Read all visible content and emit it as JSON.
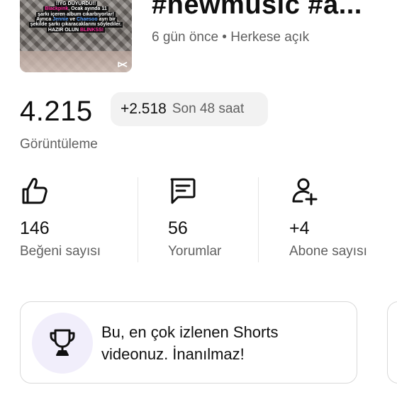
{
  "video": {
    "title": "#newmusic #a...",
    "meta": "6 gün önce • Herkese açık",
    "thumbnail_caption": {
      "line1": "!!YG DUYURDU!!",
      "line2_a": "Blackpink",
      "line2_b": ", Ocak ayında 11",
      "line3": "şarkı içeren album cıkarbıyorlar!",
      "line4_a": "Ayrıca ",
      "line4_b": "Jennie",
      "line4_c": " ve ",
      "line4_d": "Chaesoo",
      "line4_e": " ayrı bir",
      "line5": "şekilde şarkı çıkaracaklarını söylediler.",
      "line6_a": "HAZIR OLUN ",
      "line6_b": "BLINKSS!"
    }
  },
  "views": {
    "count": "4.215",
    "growth": "+2.518",
    "period": "Son 48 saat",
    "label": "Görüntüleme"
  },
  "stats": [
    {
      "icon": "thumbs-up-icon",
      "value": "146",
      "label": "Beğeni sayısı"
    },
    {
      "icon": "comment-icon",
      "value": "56",
      "label": "Yorumlar"
    },
    {
      "icon": "add-subscriber-icon",
      "value": "+4",
      "label": "Abone sayısı"
    }
  ],
  "insight": {
    "icon": "trophy-icon",
    "text": "Bu, en çok izlenen Shorts videonuz. İnanılmaz!"
  },
  "colors": {
    "text_primary": "#0f0f0f",
    "text_secondary": "#606060",
    "chip_bg": "#f2f2f2",
    "insight_icon_bg": "#f1eefb"
  }
}
